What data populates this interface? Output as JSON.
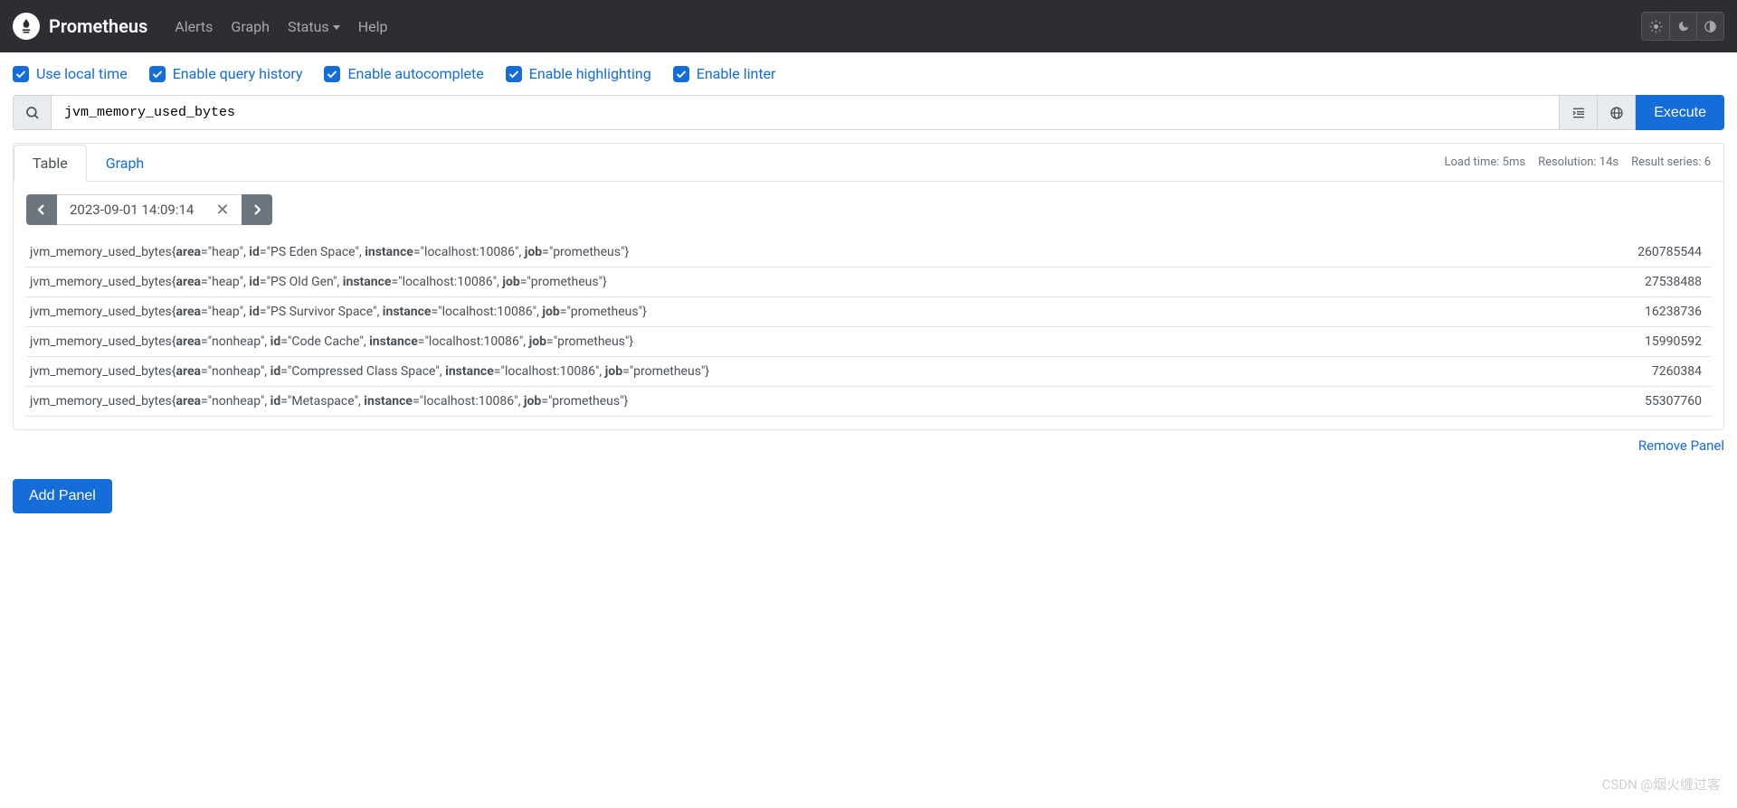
{
  "navbar": {
    "brand": "Prometheus",
    "links": {
      "alerts": "Alerts",
      "graph": "Graph",
      "status": "Status",
      "help": "Help"
    }
  },
  "options": {
    "use_local_time": "Use local time",
    "enable_history": "Enable query history",
    "enable_autocomplete": "Enable autocomplete",
    "enable_highlighting": "Enable highlighting",
    "enable_linter": "Enable linter"
  },
  "query": {
    "value": "jvm_memory_used_bytes",
    "execute": "Execute"
  },
  "tabs": {
    "table": "Table",
    "graph": "Graph"
  },
  "stats": {
    "load_time": "Load time: 5ms",
    "resolution": "Resolution: 14s",
    "result_series": "Result series: 6"
  },
  "time": {
    "value": "2023-09-01 14:09:14"
  },
  "results": [
    {
      "metric": "jvm_memory_used_bytes",
      "labels": {
        "area": "heap",
        "id": "PS Eden Space",
        "instance": "localhost:10086",
        "job": "prometheus"
      },
      "value": "260785544"
    },
    {
      "metric": "jvm_memory_used_bytes",
      "labels": {
        "area": "heap",
        "id": "PS Old Gen",
        "instance": "localhost:10086",
        "job": "prometheus"
      },
      "value": "27538488"
    },
    {
      "metric": "jvm_memory_used_bytes",
      "labels": {
        "area": "heap",
        "id": "PS Survivor Space",
        "instance": "localhost:10086",
        "job": "prometheus"
      },
      "value": "16238736"
    },
    {
      "metric": "jvm_memory_used_bytes",
      "labels": {
        "area": "nonheap",
        "id": "Code Cache",
        "instance": "localhost:10086",
        "job": "prometheus"
      },
      "value": "15990592"
    },
    {
      "metric": "jvm_memory_used_bytes",
      "labels": {
        "area": "nonheap",
        "id": "Compressed Class Space",
        "instance": "localhost:10086",
        "job": "prometheus"
      },
      "value": "7260384"
    },
    {
      "metric": "jvm_memory_used_bytes",
      "labels": {
        "area": "nonheap",
        "id": "Metaspace",
        "instance": "localhost:10086",
        "job": "prometheus"
      },
      "value": "55307760"
    }
  ],
  "actions": {
    "remove_panel": "Remove Panel",
    "add_panel": "Add Panel"
  },
  "watermark": "CSDN @烟火缠过客"
}
